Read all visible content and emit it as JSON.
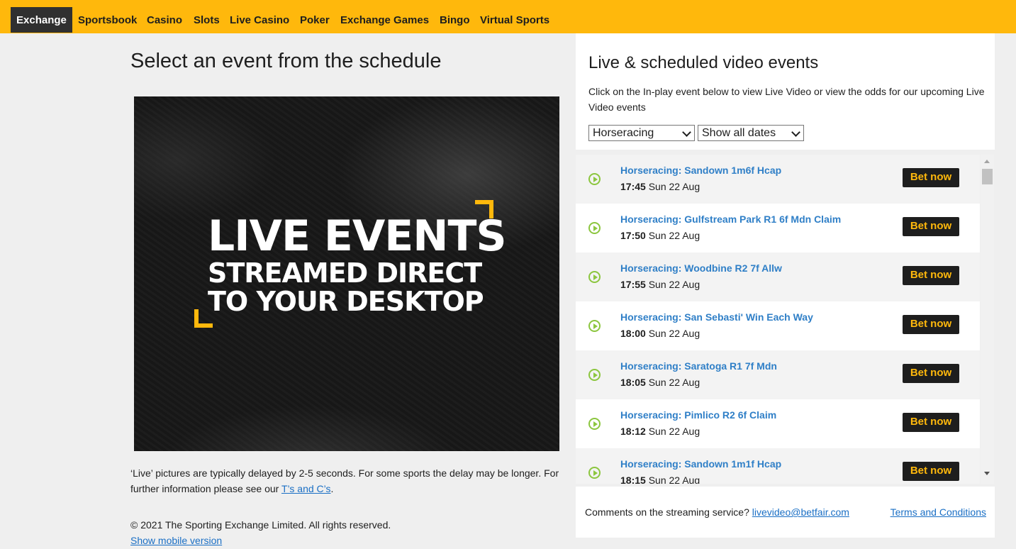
{
  "nav": {
    "tabs": [
      {
        "label": "Exchange",
        "active": true
      },
      {
        "label": "Sportsbook"
      },
      {
        "label": "Casino"
      },
      {
        "label": "Slots"
      },
      {
        "label": "Live Casino"
      },
      {
        "label": "Poker"
      },
      {
        "label": "Exchange Games"
      },
      {
        "label": "Bingo"
      },
      {
        "label": "Virtual Sports"
      }
    ]
  },
  "main": {
    "title": "Select an event from the schedule",
    "promo": {
      "line1": "LIVE EVENTS",
      "line2": "STREAMED DIRECT",
      "line3": "TO YOUR DESKTOP"
    },
    "disclaimer_text": "‘Live’ pictures are typically delayed by 2-5 seconds. For some sports the delay may be longer. For further information please see our ",
    "disclaimer_link": "T’s and C’s",
    "disclaimer_end": ".",
    "copyright": "© 2021 The Sporting Exchange Limited. All rights reserved.",
    "mobile_link": "Show mobile version"
  },
  "panel": {
    "title": "Live & scheduled video events",
    "description": "Click on the In-play event below to view Live Video or view the odds for our upcoming Live Video events",
    "sport_select": "Horseracing",
    "date_select": "Show all dates",
    "bet_label": "Bet now",
    "events": [
      {
        "name": "Horseracing: Sandown 1m6f Hcap",
        "time": "17:45",
        "date": "Sun 22 Aug"
      },
      {
        "name": "Horseracing: Gulfstream Park R1 6f Mdn Claim",
        "time": "17:50",
        "date": "Sun 22 Aug"
      },
      {
        "name": "Horseracing: Woodbine R2 7f Allw",
        "time": "17:55",
        "date": "Sun 22 Aug"
      },
      {
        "name": "Horseracing: San Sebasti' Win Each Way",
        "time": "18:00",
        "date": "Sun 22 Aug"
      },
      {
        "name": "Horseracing: Saratoga R1 7f Mdn",
        "time": "18:05",
        "date": "Sun 22 Aug"
      },
      {
        "name": "Horseracing: Pimlico R2 6f Claim",
        "time": "18:12",
        "date": "Sun 22 Aug"
      },
      {
        "name": "Horseracing: Sandown 1m1f Hcap",
        "time": "18:15",
        "date": "Sun 22 Aug"
      }
    ],
    "footer_text": "Comments on the streaming service? ",
    "footer_email": "livevideo@betfair.com",
    "footer_terms": "Terms and Conditions"
  },
  "colors": {
    "brand": "#ffb80c",
    "link": "#2f7fc7",
    "play": "#8cc63f"
  }
}
